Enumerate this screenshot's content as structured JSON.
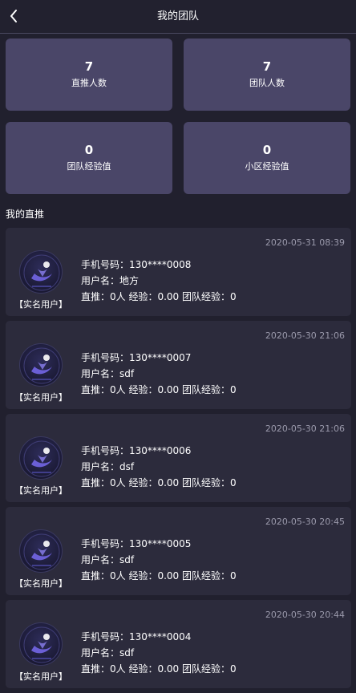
{
  "header": {
    "title": "我的团队"
  },
  "stats": [
    {
      "value": "7",
      "label": "直推人数"
    },
    {
      "value": "7",
      "label": "团队人数"
    },
    {
      "value": "0",
      "label": "团队经验值"
    },
    {
      "value": "0",
      "label": "小区经验值"
    }
  ],
  "section_title": "我的直推",
  "members": [
    {
      "time": "2020-05-31 08:39",
      "badge": "【实名用户】",
      "phone": "手机号码：130****0008",
      "username": "用户名：地方",
      "stats": "直推：0人  经验：0.00  团队经验：0"
    },
    {
      "time": "2020-05-30 21:06",
      "badge": "【实名用户】",
      "phone": "手机号码：130****0007",
      "username": "用户名：sdf",
      "stats": "直推：0人  经验：0.00  团队经验：0"
    },
    {
      "time": "2020-05-30 21:06",
      "badge": "【实名用户】",
      "phone": "手机号码：130****0006",
      "username": "用户名：dsf",
      "stats": "直推：0人  经验：0.00  团队经验：0"
    },
    {
      "time": "2020-05-30 20:45",
      "badge": "【实名用户】",
      "phone": "手机号码：130****0005",
      "username": "用户名：sdf",
      "stats": "直推：0人  经验：0.00  团队经验：0"
    },
    {
      "time": "2020-05-30 20:44",
      "badge": "【实名用户】",
      "phone": "手机号码：130****0004",
      "username": "用户名：sdf",
      "stats": "直推：0人  经验：0.00  团队经验：0"
    }
  ],
  "icons": {
    "back": "chevron-left-icon",
    "avatar": "logo-avatar-icon"
  },
  "colors": {
    "background": "#21202e",
    "stat_card": "#4a4668",
    "list_card": "#2c2b3c",
    "time_text": "#9a99ab"
  }
}
